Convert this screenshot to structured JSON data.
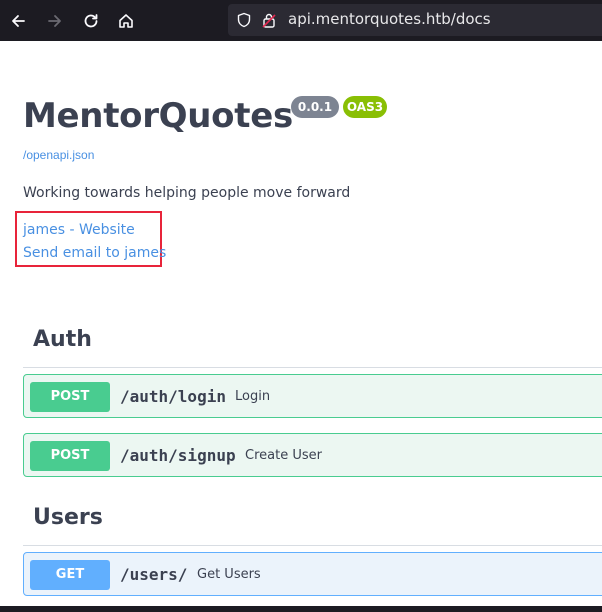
{
  "browser": {
    "url": "api.mentorquotes.htb/docs",
    "icons": {
      "back": "arrow-left-icon",
      "forward": "arrow-right-icon",
      "reload": "reload-icon",
      "home": "home-icon",
      "shield": "shield-icon",
      "lock": "insecure-lock-icon"
    }
  },
  "info": {
    "title": "MentorQuotes",
    "version": "0.0.1",
    "oas_badge": "OAS3",
    "spec_link": "/openapi.json",
    "description": "Working towards helping people move forward",
    "contact": {
      "website_label": "james - Website",
      "email_label": "Send email to james"
    }
  },
  "sections": [
    {
      "name": "Auth",
      "operations": [
        {
          "method": "POST",
          "path": "/auth/login",
          "summary": "Login"
        },
        {
          "method": "POST",
          "path": "/auth/signup",
          "summary": "Create User"
        }
      ]
    },
    {
      "name": "Users",
      "operations": [
        {
          "method": "GET",
          "path": "/users/",
          "summary": "Get Users"
        }
      ]
    }
  ],
  "colors": {
    "post": "#49cc90",
    "get": "#61affe",
    "highlight": "#e8243a",
    "link": "#4990e2",
    "text": "#3b4151"
  }
}
